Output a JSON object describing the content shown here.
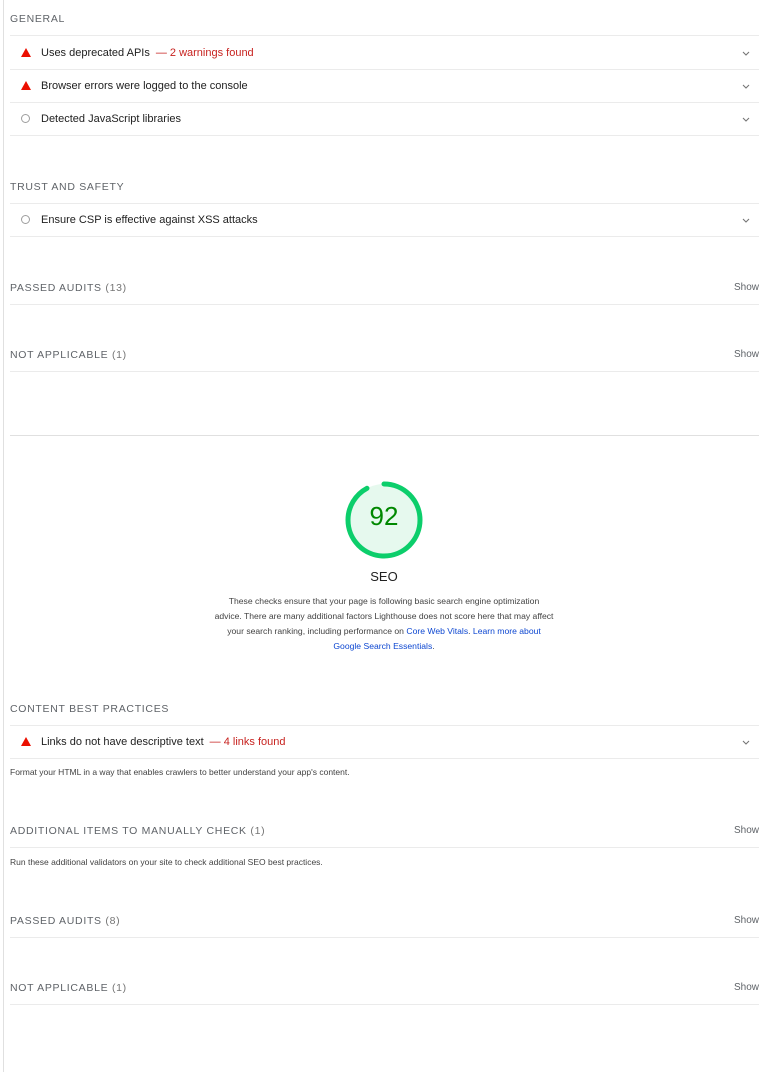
{
  "best_practices": {
    "general": {
      "title": "GENERAL",
      "audits": [
        {
          "title": "Uses deprecated APIs",
          "warning": "— 2 warnings found",
          "icon": "fail-triangle-icon"
        },
        {
          "title": "Browser errors were logged to the console",
          "warning": "",
          "icon": "fail-triangle-icon"
        },
        {
          "title": "Detected JavaScript libraries",
          "warning": "",
          "icon": "informative-circle-icon"
        }
      ]
    },
    "trust_safety": {
      "title": "TRUST AND SAFETY",
      "audits": [
        {
          "title": "Ensure CSP is effective against XSS attacks",
          "warning": "",
          "icon": "informative-circle-icon"
        }
      ]
    },
    "passed": {
      "title": "PASSED AUDITS",
      "count": "(13)",
      "show": "Show"
    },
    "not_applicable": {
      "title": "NOT APPLICABLE",
      "count": "(1)",
      "show": "Show"
    }
  },
  "seo": {
    "score": "92",
    "score_fraction": 0.92,
    "score_color": "#0cce6b",
    "label": "SEO",
    "description": "These checks ensure that your page is following basic search engine optimization advice. There are many additional factors Lighthouse does not score here that may affect your search ranking, including performance on",
    "link1": "Core Web Vitals",
    "link2": "Learn more about Google Search Essentials",
    "content_best_practices": {
      "title": "CONTENT BEST PRACTICES",
      "audits": [
        {
          "title": "Links do not have descriptive text",
          "warning": "— 4 links found",
          "icon": "fail-triangle-icon"
        }
      ],
      "description": "Format your HTML in a way that enables crawlers to better understand your app's content."
    },
    "manual": {
      "title": "ADDITIONAL ITEMS TO MANUALLY CHECK",
      "count": "(1)",
      "show": "Show",
      "description": "Run these additional validators on your site to check additional SEO best practices."
    },
    "passed": {
      "title": "PASSED AUDITS",
      "count": "(8)",
      "show": "Show"
    },
    "not_applicable": {
      "title": "NOT APPLICABLE",
      "count": "(1)",
      "show": "Show"
    }
  },
  "colors": {
    "fail": "#eb0f00",
    "warning_text": "#c7221f",
    "pass": "#0cce6b",
    "link": "#0d47d1"
  }
}
